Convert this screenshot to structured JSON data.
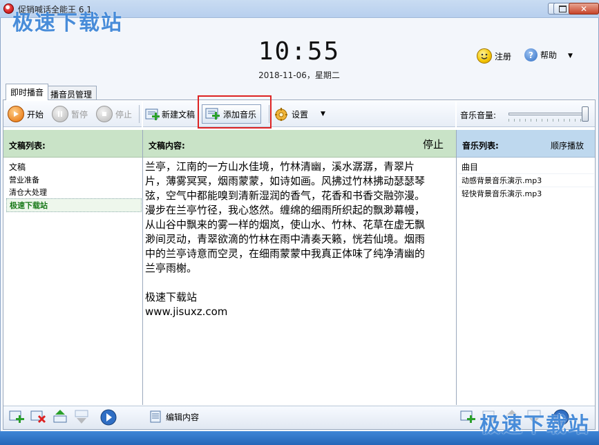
{
  "window": {
    "title": "促销喊话全能王 6.1"
  },
  "watermark": {
    "top": "极速下载站",
    "bottom": "极速下载站"
  },
  "clock": {
    "time": "10:55",
    "date": "2018-11-06，星期二"
  },
  "header": {
    "register_label": "注册",
    "help_label": "帮助"
  },
  "tabs": [
    {
      "label": "即时播音"
    },
    {
      "label": "播音员管理"
    }
  ],
  "toolbar": {
    "start": "开始",
    "pause": "暂停",
    "stop": "停止",
    "new_script": "新建文稿",
    "add_music": "添加音乐",
    "settings": "设置",
    "volume_label": "音乐音量:",
    "volume_level": 1.0
  },
  "scripts": {
    "header": "文稿列表:",
    "column": "文稿",
    "items": [
      "营业准备",
      "清仓大处理",
      "极速下载站"
    ],
    "selected_index": 2
  },
  "content": {
    "header": "文稿内容:",
    "status": "停止",
    "text": "兰亭，江南的一方山水佳境，竹林清幽，溪水潺潺，青翠片\n片，薄雾冥冥，烟雨蒙蒙，如诗如画。风拂过竹林拂动瑟瑟琴\n弦，空气中都能嗅到清新湿润的香气，花香和书香交融弥漫。\n漫步在兰亭竹径，我心悠然。缠绵的细雨所织起的飘渺幕幔，\n从山谷中飘来的雾一样的烟岚，使山水、竹林、花草在虚无飘\n渺间灵动，青翠欲滴的竹林在雨中清奏天籁，恍若仙境。烟雨\n中的兰亭诗意而空灵，在细雨蒙蒙中我真正体味了纯净清幽的\n兰亭雨榭。\n\n极速下载站\nwww.jisuxz.com",
    "edit_label": "编辑内容"
  },
  "music": {
    "header": "音乐列表:",
    "mode": "顺序播放",
    "column": "曲目",
    "items": [
      "动感背景音乐演示.mp3",
      "轻快背景音乐演示.mp3"
    ]
  }
}
